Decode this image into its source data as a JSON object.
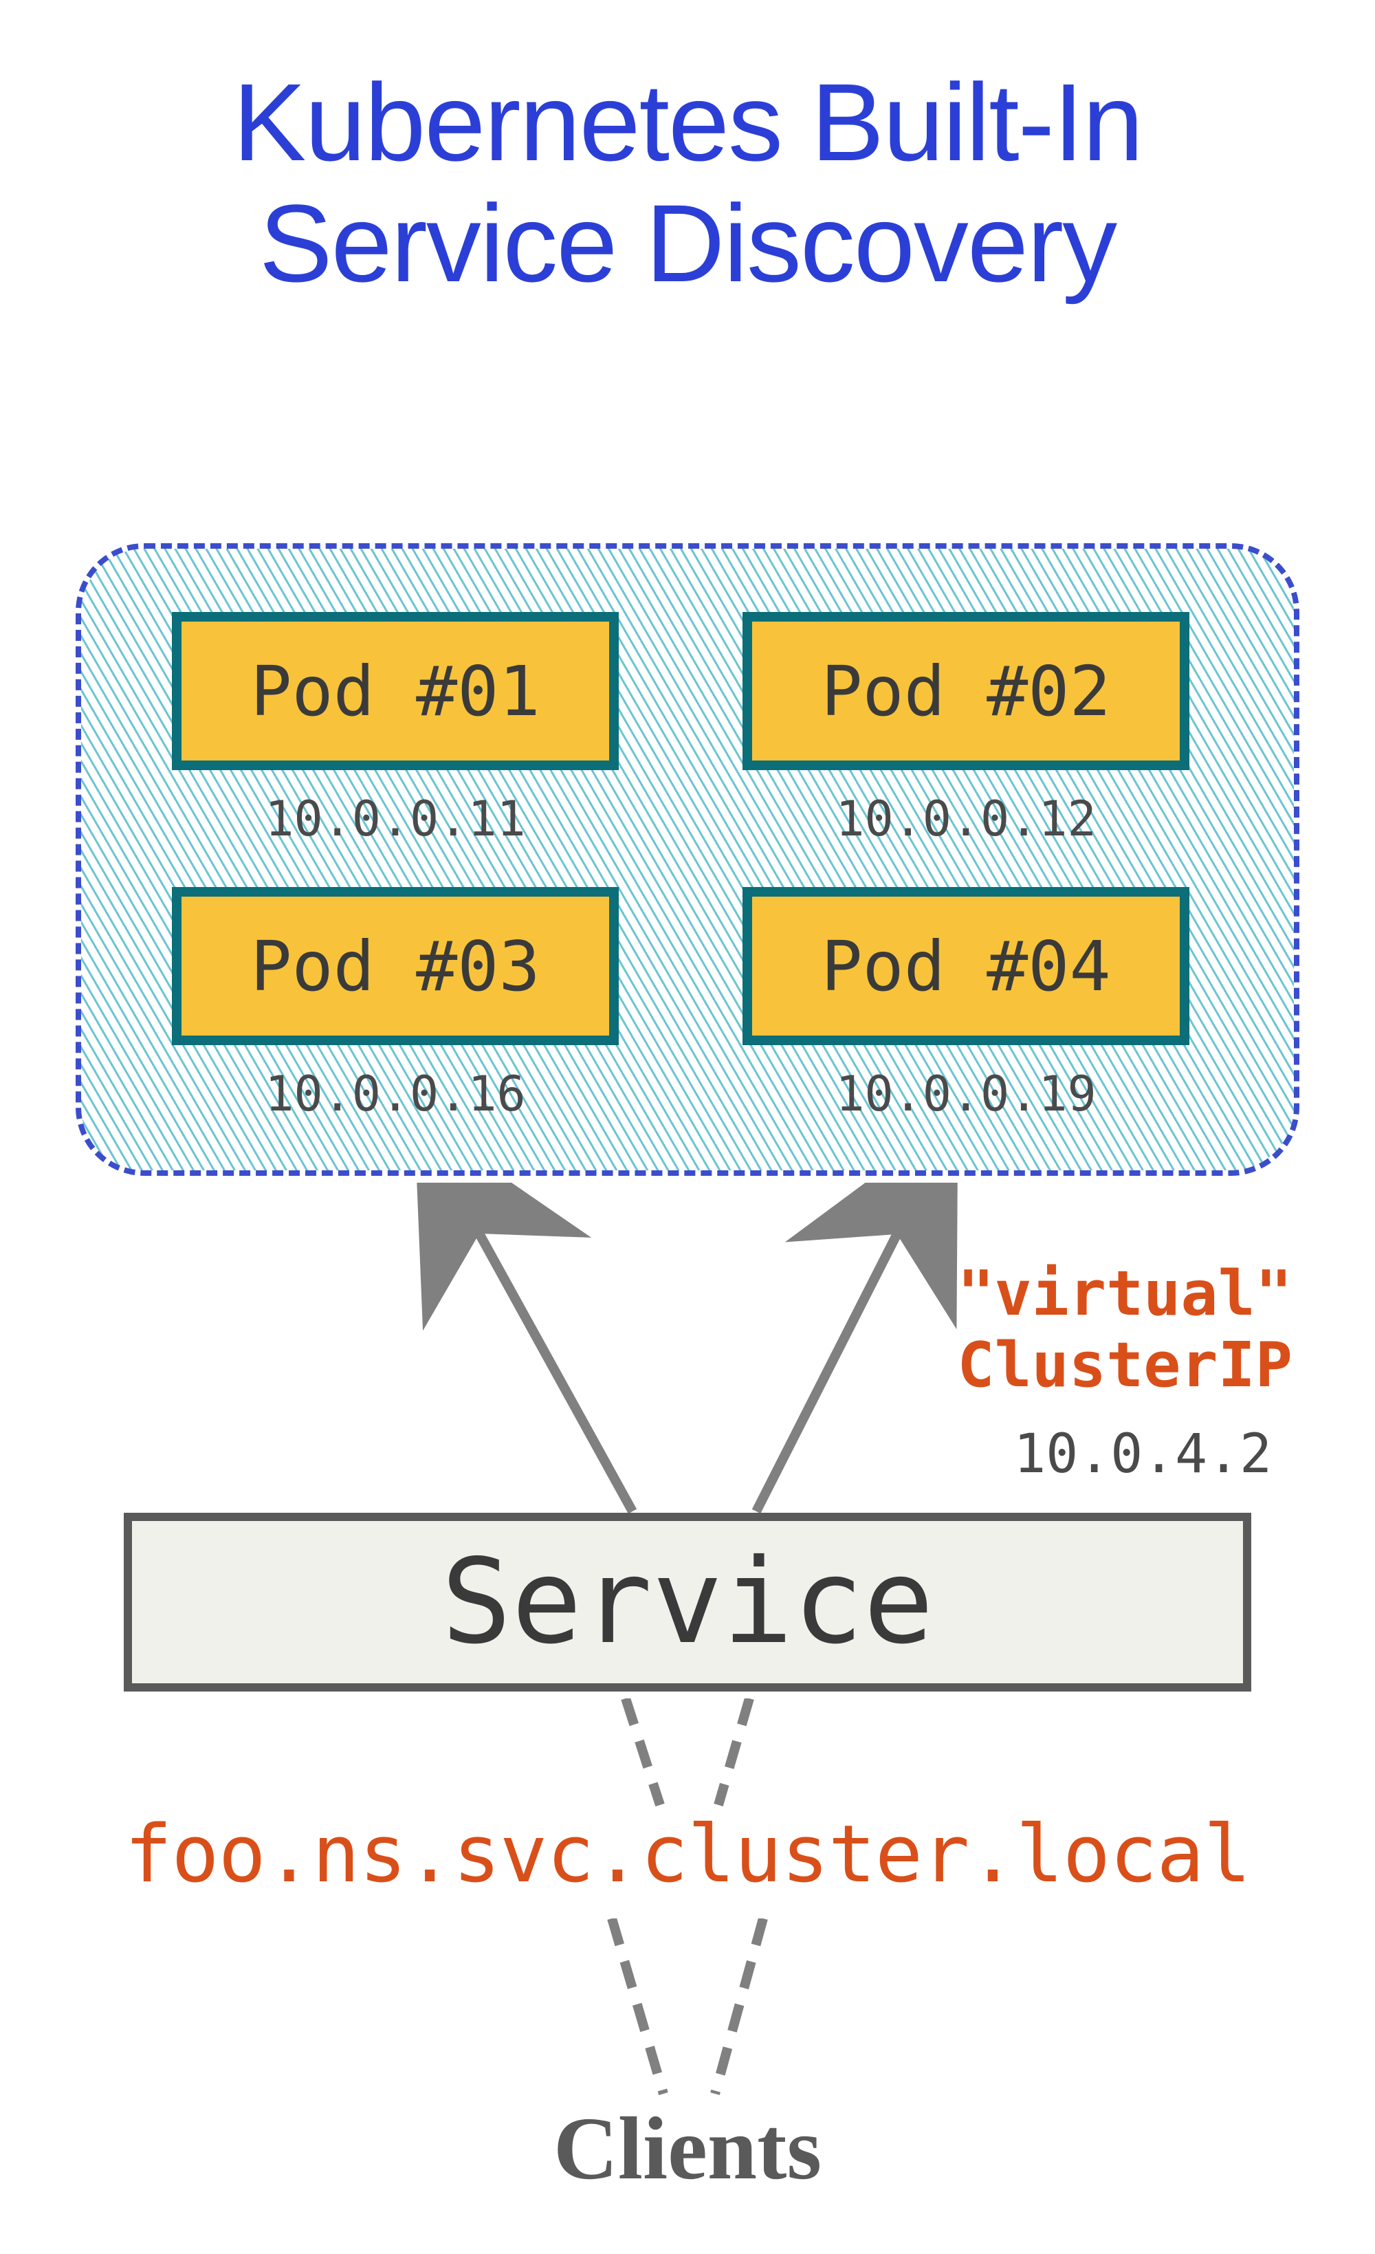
{
  "title_line1": "Kubernetes Built-In",
  "title_line2": "Service Discovery",
  "pods": [
    {
      "label": "Pod #01",
      "ip": "10.0.0.11"
    },
    {
      "label": "Pod #02",
      "ip": "10.0.0.12"
    },
    {
      "label": "Pod #03",
      "ip": "10.0.0.16"
    },
    {
      "label": "Pod #04",
      "ip": "10.0.0.19"
    }
  ],
  "cluster_ip_label_line1": "\"virtual\"",
  "cluster_ip_label_line2": "ClusterIP",
  "cluster_ip_value": "10.0.4.2",
  "service_label": "Service",
  "dns_name": "foo.ns.svc.cluster.local",
  "clients_label": "Clients"
}
